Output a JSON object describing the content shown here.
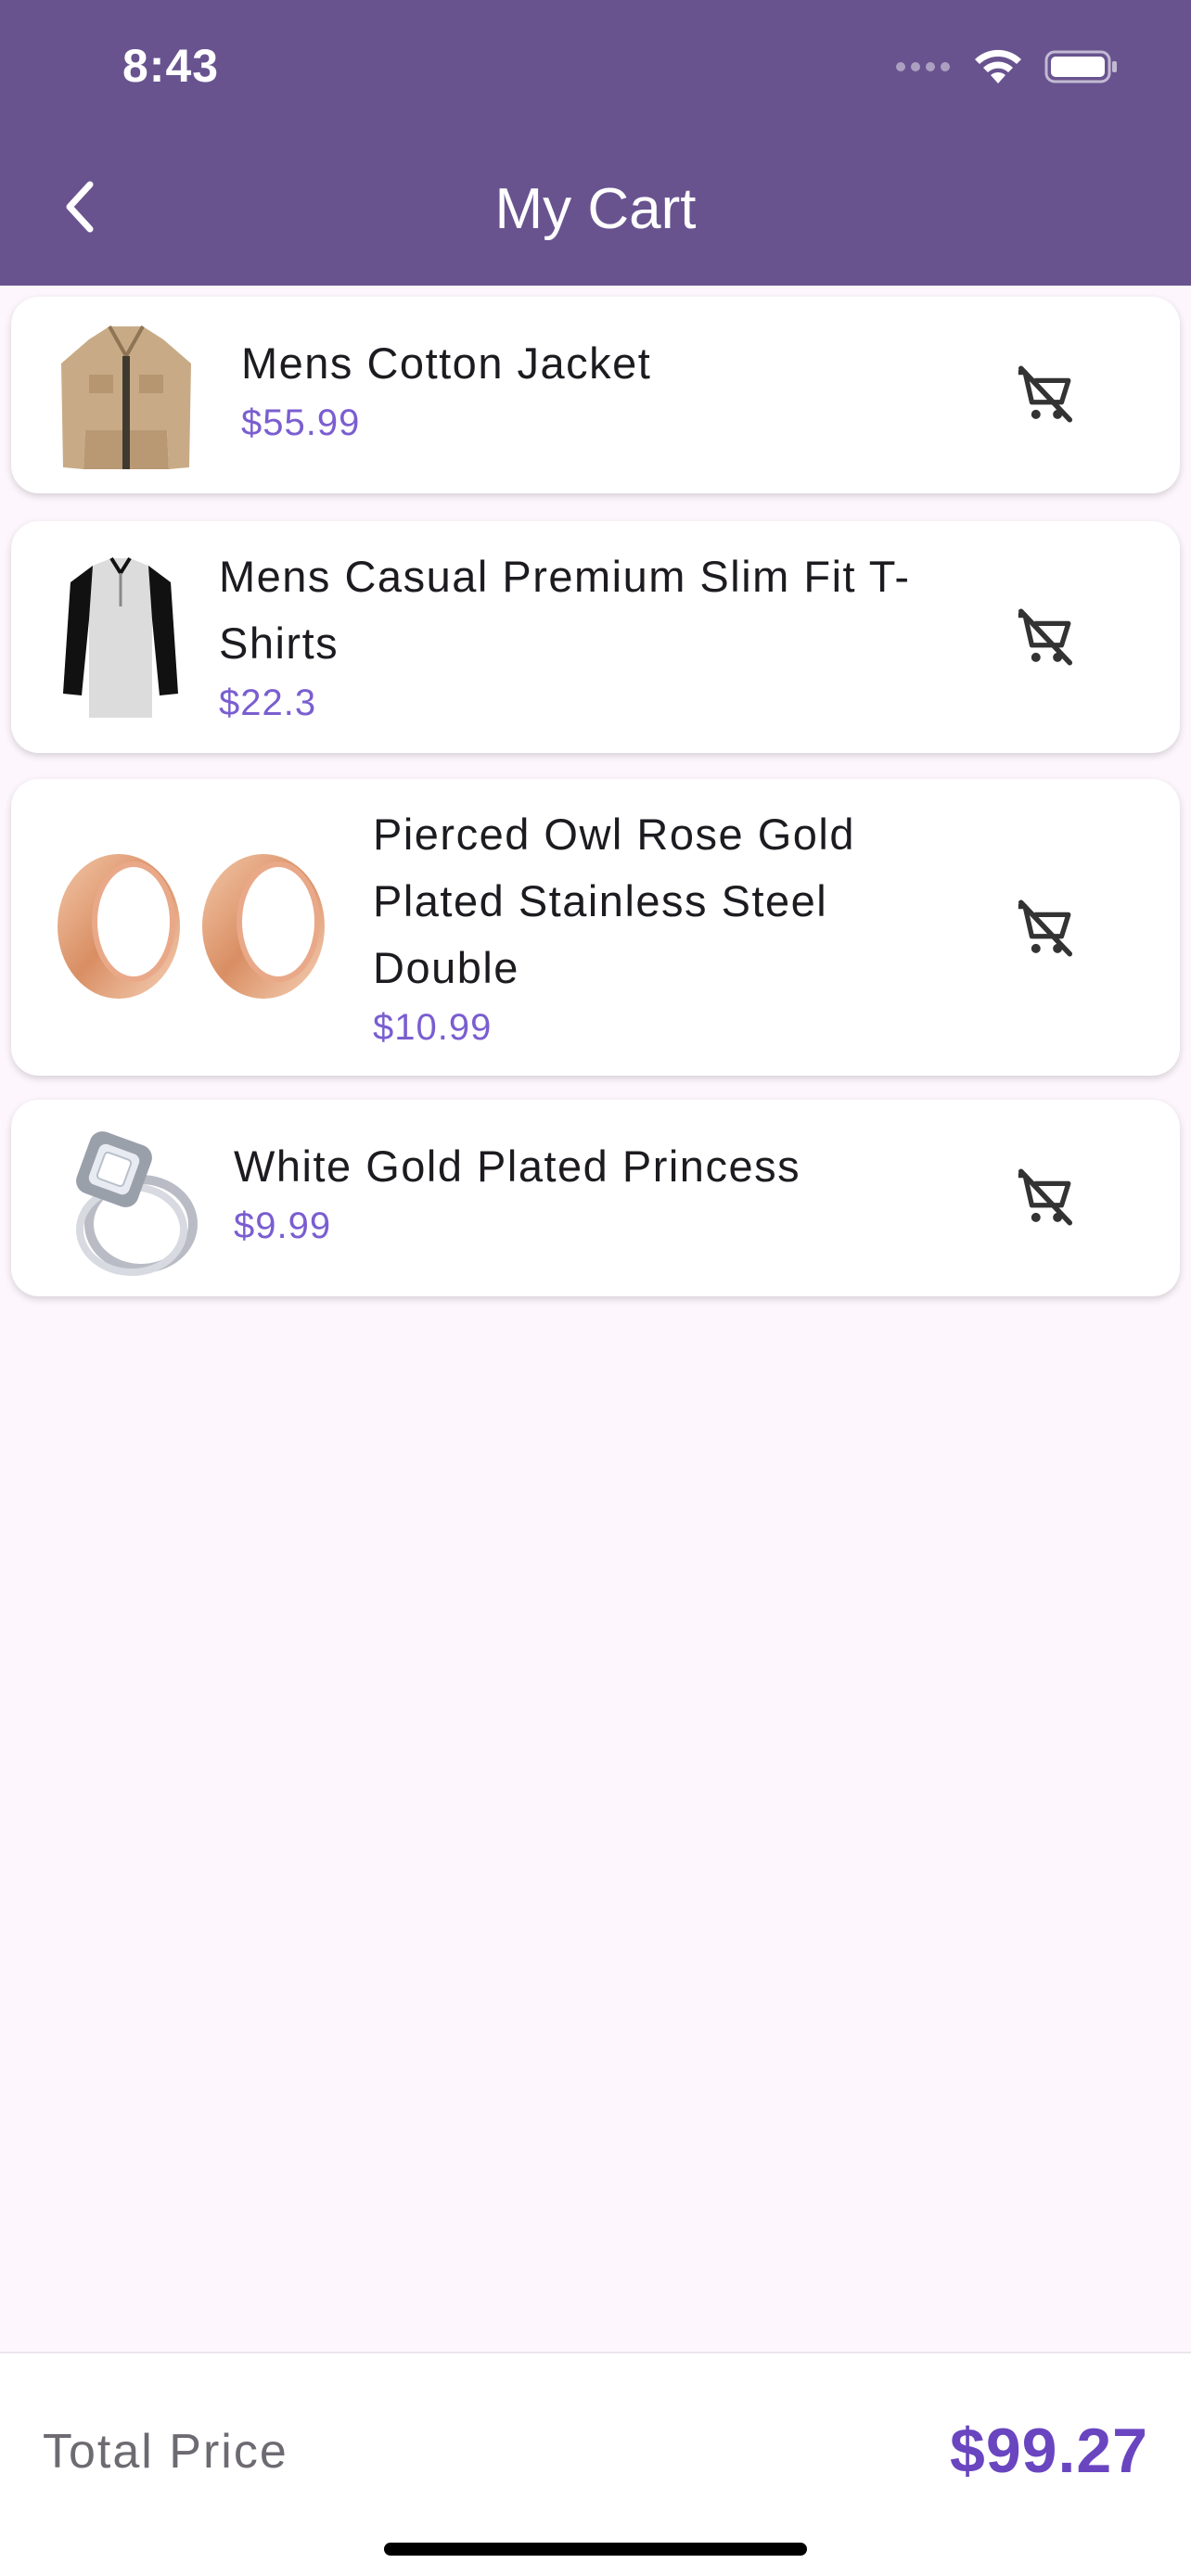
{
  "status_bar": {
    "time": "8:43"
  },
  "header": {
    "title": "My Cart",
    "colors": {
      "background": "#68538f"
    }
  },
  "cart": {
    "items": [
      {
        "name": "Mens Cotton Jacket",
        "price": "$55.99",
        "image": "jacket-image"
      },
      {
        "name": "Mens Casual Premium Slim Fit T-Shirts",
        "price": "$22.3",
        "image": "tshirt-image"
      },
      {
        "name": "Pierced Owl Rose Gold Plated Stainless Steel Double",
        "price": "$10.99",
        "image": "rose-gold-plugs-image"
      },
      {
        "name": "White Gold Plated Princess",
        "price": "$9.99",
        "image": "ring-image"
      }
    ],
    "remove_icon": "remove-shopping-cart-icon"
  },
  "footer": {
    "total_label": "Total Price",
    "total_value": "$99.27"
  },
  "colors": {
    "price": "#7a5ed0",
    "total": "#6a45c0",
    "page_background": "#fdf7fd"
  }
}
